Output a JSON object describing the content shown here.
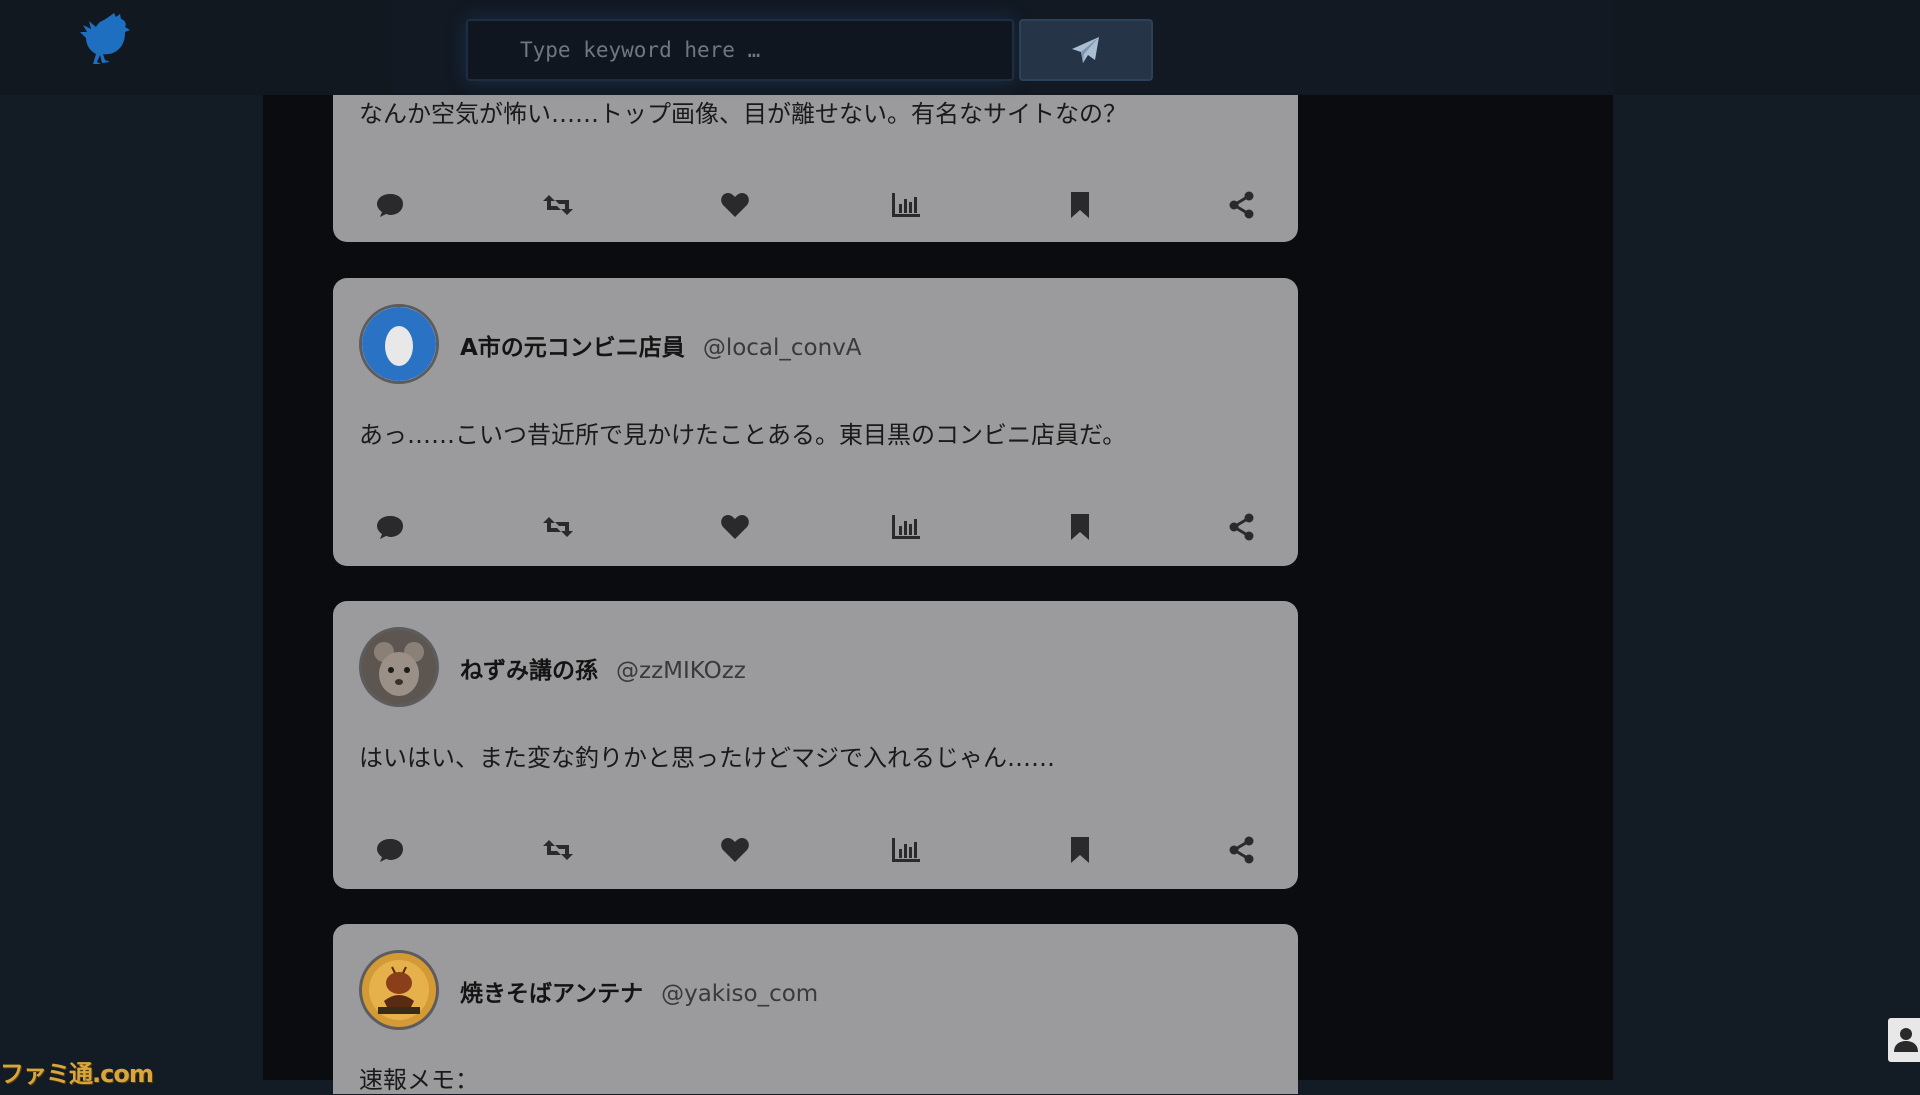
{
  "header": {
    "search_placeholder": "Type keyword here …",
    "logo_icon": "rooster-icon",
    "send_icon": "paper-plane-icon"
  },
  "posts": [
    {
      "name": "",
      "handle": "",
      "text": "なんか空気が怖い……トップ画像、目が離せない。有名なサイトなの？"
    },
    {
      "name": "A市の元コンビニ店員",
      "handle": "@local_convA",
      "avatar_icon": "blue-egg-avatar",
      "text": "あっ……こいつ昔近所で見かけたことある。東目黒のコンビニ店員だ。"
    },
    {
      "name": "ねずみ講の孫",
      "handle": "@zzMIKOzz",
      "avatar_icon": "mouse-avatar",
      "text": "はいはい、また変な釣りかと思ったけどマジで入れるじゃん……"
    },
    {
      "name": "焼きそばアンテナ",
      "handle": "@yakiso_com",
      "avatar_icon": "yakisoba-mascot-avatar",
      "text": "速報メモ："
    }
  ],
  "action_icons": [
    "comment-icon",
    "retweet-icon",
    "heart-icon",
    "stats-icon",
    "bookmark-icon",
    "share-icon"
  ],
  "watermark": "ファミ通.com",
  "colors": {
    "background": "#131b24",
    "feed": "#0a0c0f",
    "card": "#9b9b9d",
    "accent": "#2a73c4"
  }
}
